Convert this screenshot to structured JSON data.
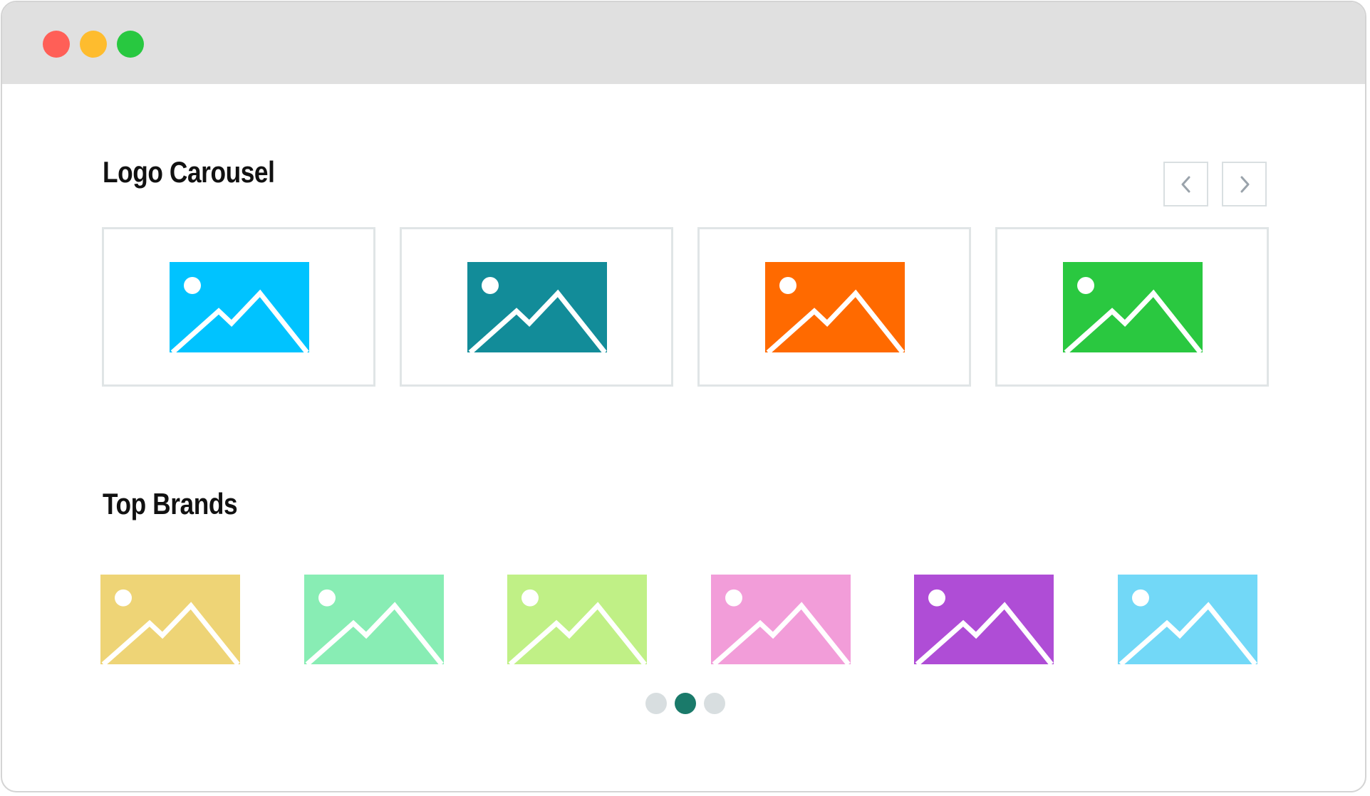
{
  "window": {
    "controls": [
      {
        "name": "close",
        "color": "#ff5f57"
      },
      {
        "name": "minimize",
        "color": "#febc2e"
      },
      {
        "name": "maximize",
        "color": "#28c840"
      }
    ]
  },
  "logo_carousel": {
    "title": "Logo Carousel",
    "prev_icon": "chevron-left-icon",
    "next_icon": "chevron-right-icon",
    "nav_icon_color": "#9aa3ab",
    "card_border_color": "#e0e5e6",
    "logos": [
      {
        "icon": "image-placeholder-icon",
        "color": "#00c3ff"
      },
      {
        "icon": "image-placeholder-icon",
        "color": "#128c99"
      },
      {
        "icon": "image-placeholder-icon",
        "color": "#ff6a00"
      },
      {
        "icon": "image-placeholder-icon",
        "color": "#2ac840"
      }
    ]
  },
  "top_brands": {
    "title": "Top Brands",
    "brands": [
      {
        "icon": "image-placeholder-icon",
        "color": "#eed476"
      },
      {
        "icon": "image-placeholder-icon",
        "color": "#88edb4"
      },
      {
        "icon": "image-placeholder-icon",
        "color": "#c0f086"
      },
      {
        "icon": "image-placeholder-icon",
        "color": "#f29dd9"
      },
      {
        "icon": "image-placeholder-icon",
        "color": "#af4dd6"
      },
      {
        "icon": "image-placeholder-icon",
        "color": "#72d8f7"
      }
    ],
    "pagination": {
      "pages": 3,
      "active_page": 2,
      "active_color": "#1a7a6a",
      "inactive_color": "#d8dee0"
    }
  }
}
